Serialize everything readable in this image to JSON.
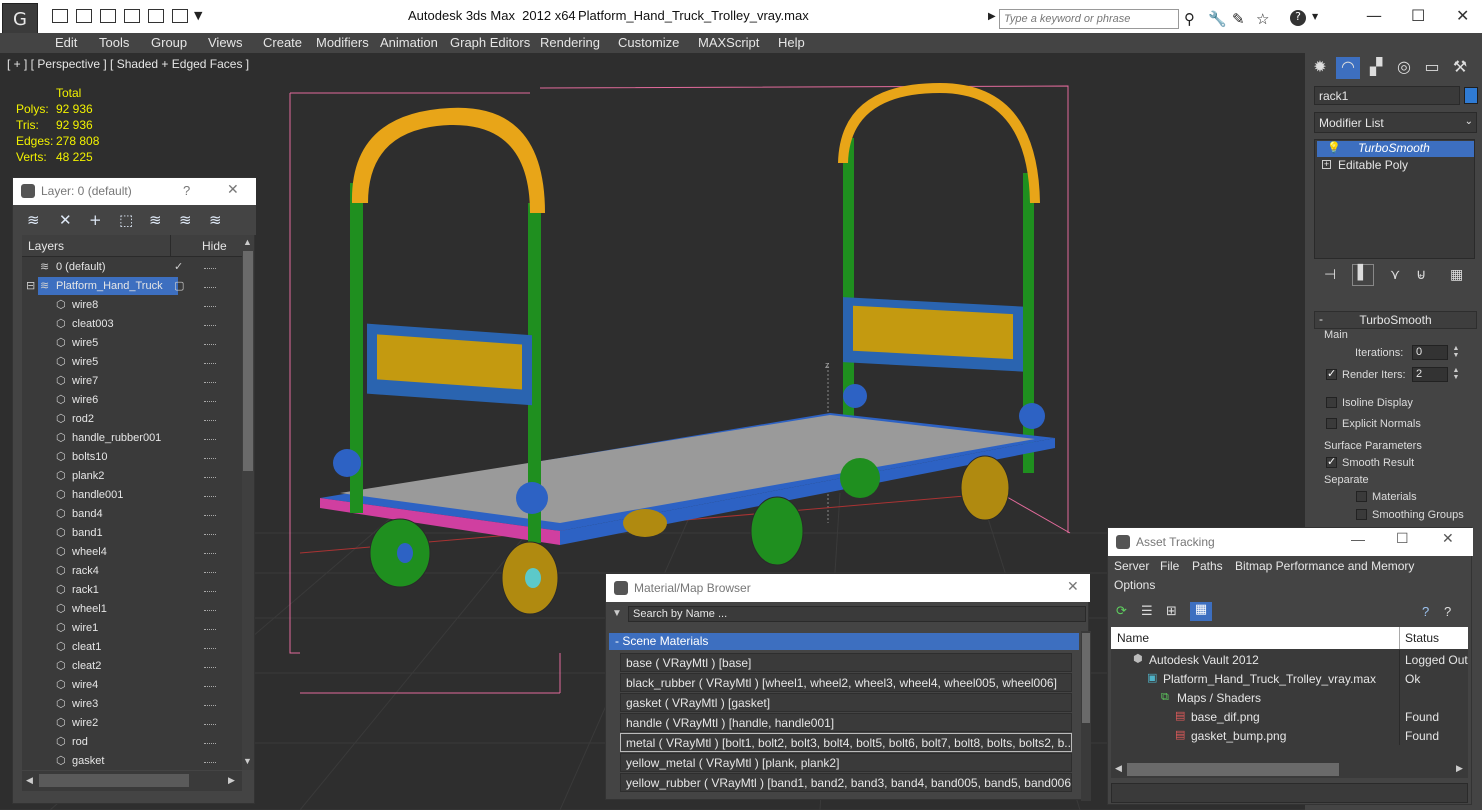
{
  "titlebar": {
    "app_title": "Autodesk 3ds Max  2012 x64",
    "file_name": "Platform_Hand_Truck_Trolley_vray.max",
    "search_placeholder": "Type a keyword or phrase",
    "help_icon": "?"
  },
  "menu": [
    "Edit",
    "Tools",
    "Group",
    "Views",
    "Create",
    "Modifiers",
    "Animation",
    "Graph Editors",
    "Rendering",
    "Customize",
    "MAXScript",
    "Help"
  ],
  "viewport": {
    "label": "[ + ] [ Perspective ] [ Shaded + Edged Faces ]",
    "stats": {
      "total_label": "Total",
      "polys_label": "Polys:",
      "polys": "92 936",
      "tris_label": "Tris:",
      "tris": "92 936",
      "edges_label": "Edges:",
      "edges": "278 808",
      "verts_label": "Verts:",
      "verts": "48 225"
    },
    "axis_z": "z"
  },
  "command_panel": {
    "object_name": "rack1",
    "object_color": "#2f7bd4",
    "modifier_list": "Modifier List",
    "stack": [
      "TurboSmooth",
      "Editable Poly"
    ],
    "rollout_title": "TurboSmooth",
    "main_label": "Main",
    "iterations_label": "Iterations:",
    "iterations": "0",
    "render_iters_label": "Render Iters:",
    "render_iters": "2",
    "render_iters_checked": true,
    "isoline_label": "Isoline Display",
    "explicit_normals_label": "Explicit Normals",
    "surface_params_label": "Surface Parameters",
    "smooth_result_label": "Smooth Result",
    "smooth_result_checked": true,
    "separate_label": "Separate",
    "materials_label": "Materials",
    "smoothing_groups_label": "Smoothing Groups"
  },
  "layer_dialog": {
    "title": "Layer: 0 (default)",
    "help": "?",
    "columns": {
      "layers": "Layers",
      "hide": "Hide"
    },
    "layers": [
      {
        "name": "0 (default)",
        "level": 0,
        "kind": "layer",
        "checked": true
      },
      {
        "name": "Platform_Hand_Truck",
        "level": 0,
        "kind": "layer",
        "selected": true
      }
    ],
    "objects": [
      "wire8",
      "cleat003",
      "wire5",
      "wire5",
      "wire7",
      "wire6",
      "rod2",
      "handle_rubber001",
      "bolts10",
      "plank2",
      "handle001",
      "band4",
      "band1",
      "wheel4",
      "rack4",
      "rack1",
      "wheel1",
      "wire1",
      "cleat1",
      "cleat2",
      "wire4",
      "wire3",
      "wire2",
      "rod",
      "gasket"
    ]
  },
  "material_browser": {
    "title": "Material/Map Browser",
    "search_placeholder": "Search by Name ...",
    "group": "- Scene Materials",
    "materials": [
      "base  ( VRayMtl )  [base]",
      "black_rubber  ( VRayMtl )  [wheel1, wheel2, wheel3, wheel4, wheel005, wheel006]",
      "gasket  ( VRayMtl )  [gasket]",
      "handle  ( VRayMtl )  [handle, handle001]",
      "metal  ( VRayMtl ) [bolt1, bolt2, bolt3, bolt4, bolt5, bolt6, bolt7, bolt8, bolts, bolts2, b...",
      "yellow_metal  ( VRayMtl )  [plank, plank2]",
      "yellow_rubber  ( VRayMtl )  [band1, band2, band3, band4, band005, band5, band006,..."
    ],
    "selected_index": 4
  },
  "asset_tracking": {
    "title": "Asset Tracking",
    "menu": [
      "Server",
      "File",
      "Paths",
      "Bitmap Performance and Memory",
      "Options"
    ],
    "columns": {
      "name": "Name",
      "status": "Status"
    },
    "rows": [
      {
        "name": "Autodesk Vault 2012",
        "status": "Logged Out",
        "indent": 1,
        "icon": "vault-icon"
      },
      {
        "name": "Platform_Hand_Truck_Trolley_vray.max",
        "status": "Ok",
        "indent": 2,
        "icon": "max-file-icon"
      },
      {
        "name": "Maps / Shaders",
        "status": "",
        "indent": 3,
        "icon": "folder-icon"
      },
      {
        "name": "base_dif.png",
        "status": "Found",
        "indent": 4,
        "icon": "png-icon"
      },
      {
        "name": "gasket_bump.png",
        "status": "Found",
        "indent": 4,
        "icon": "png-icon"
      }
    ]
  }
}
